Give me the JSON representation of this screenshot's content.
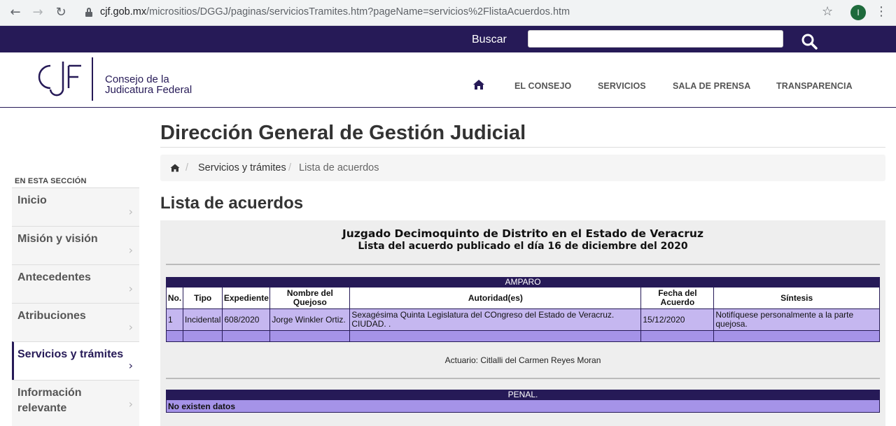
{
  "browser": {
    "url_host": "cjf.gob.mx",
    "url_path": "/micrositios/DGGJ/paginas/serviciosTramites.htm?pageName=servicios%2FlistaAcuerdos.htm",
    "profile_initial": "I"
  },
  "search": {
    "label": "Buscar",
    "value": ""
  },
  "logo": {
    "line1": "Consejo de la",
    "line2": "Judicatura Federal"
  },
  "nav": {
    "items": [
      "EL CONSEJO",
      "SERVICIOS",
      "SALA DE PRENSA",
      "TRANSPARENCIA"
    ]
  },
  "page_title": "Dirección General de Gestión Judicial",
  "breadcrumb": {
    "link": "Servicios y trámites",
    "current": "Lista de acuerdos"
  },
  "section_title": "Lista de acuerdos",
  "sidebar": {
    "heading": "EN ESTA SECCIÓN",
    "items": [
      {
        "label": "Inicio"
      },
      {
        "label": "Misión y visión"
      },
      {
        "label": "Antecedentes"
      },
      {
        "label": "Atribuciones"
      },
      {
        "label": "Servicios y trámites"
      },
      {
        "label": "Información relevante"
      }
    ]
  },
  "court": {
    "name": "Juzgado Decimoquinto de Distrito en el Estado de Veracruz",
    "subtitle": "Lista del acuerdo publicado el día 16 de diciembre del 2020"
  },
  "amparo": {
    "title": "AMPARO",
    "headers": [
      "No.",
      "Tipo",
      "Expediente",
      "Nombre del Quejoso",
      "Autoridad(es)",
      "Fecha del Acuerdo",
      "Síntesis"
    ],
    "rows": [
      [
        "1",
        "Incidental",
        "608/2020",
        "Jorge Winkler Ortiz.",
        "Sexagésima Quinta Legislatura del COngreso del Estado de Veracruz. CIUDAD. .",
        "15/12/2020",
        "Notifíquese personalmente a la parte quejosa."
      ]
    ]
  },
  "actuario": "Actuario: Citlalli del Carmen Reyes Moran",
  "penal": {
    "title": "PENAL.",
    "message": "No existen datos"
  },
  "colors": {
    "primary": "#261a57",
    "row": "#c5b7f0",
    "row_alt": "#a593e8"
  }
}
